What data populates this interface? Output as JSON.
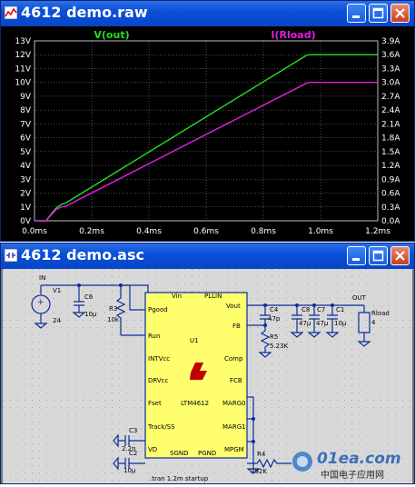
{
  "plot_window": {
    "title": "4612 demo.raw",
    "traces": {
      "left": "V(out)",
      "right": "I(Rload)"
    },
    "y_left_ticks": [
      "13V",
      "12V",
      "11V",
      "10V",
      "9V",
      "8V",
      "7V",
      "6V",
      "5V",
      "4V",
      "3V",
      "2V",
      "1V",
      "0V"
    ],
    "y_right_ticks": [
      "3.9A",
      "3.6A",
      "3.3A",
      "3.0A",
      "2.7A",
      "2.4A",
      "2.1A",
      "1.8A",
      "1.5A",
      "1.2A",
      "0.9A",
      "0.6A",
      "0.3A",
      "0.0A"
    ],
    "x_ticks": [
      "0.0ms",
      "0.2ms",
      "0.4ms",
      "0.6ms",
      "0.8ms",
      "1.0ms",
      "1.2ms"
    ],
    "colors": {
      "vout": "#22e022",
      "iload": "#e020e0",
      "grid": "#9a9a9a"
    }
  },
  "chart_data": {
    "type": "line",
    "x_unit": "ms",
    "ylim_left": [
      0,
      13
    ],
    "ylim_right": [
      0,
      3.9
    ],
    "xlim": [
      0,
      1.2
    ],
    "grid": true,
    "series": [
      {
        "name": "V(out)",
        "axis": "left",
        "x": [
          0.0,
          0.04,
          0.075,
          0.095,
          0.11,
          0.95,
          0.96,
          1.2
        ],
        "y": [
          0.0,
          0.0,
          0.9,
          1.2,
          1.3,
          11.95,
          12.0,
          12.0
        ]
      },
      {
        "name": "I(Rload)",
        "axis": "right",
        "x": [
          0.0,
          0.04,
          0.075,
          0.095,
          0.11,
          0.95,
          0.96,
          1.2
        ],
        "y": [
          0.0,
          0.0,
          0.24,
          0.3,
          0.32,
          2.98,
          3.0,
          3.0
        ]
      }
    ]
  },
  "sch_window": {
    "title": "4612 demo.asc",
    "labels": {
      "in": "IN",
      "out": "OUT",
      "v1": "V1",
      "v1val": "24",
      "c6": "C6",
      "c6val": "10µ",
      "r3": "R3",
      "r3val": "10k",
      "u1": "U1",
      "part": "LTM4612",
      "c4": "C4",
      "c4val": "47p",
      "r5": "R5",
      "r5val": "5.23K",
      "c8": "C8",
      "c8val": "47µ",
      "c7": "C7",
      "c7val": "47µ",
      "c1": "C1",
      "c1val": "10µ",
      "rload": "Rload",
      "rloadval": "4",
      "c3": "C3",
      "c3val": "2.2n",
      "c2": "C2",
      "c2val": "10µ",
      "r4": "R4",
      "r4val": "392K",
      "tran": ".tran 1.2m startup"
    },
    "pins": {
      "vin": "Vin",
      "pllin": "PLLIN",
      "vout": "Vout",
      "pgood": "Pgood",
      "run": "Run",
      "fb": "FB",
      "intvcc": "INTVcc",
      "comp": "Comp",
      "drvcc": "DRVcc",
      "fcb": "FCB",
      "fset": "Fset",
      "marg0": "MARG0",
      "track": "Track/SS",
      "marg1": "MARG1",
      "vd": "VD",
      "mpgm": "MPGM",
      "sgnd": "SGND",
      "pgnd": "PGND"
    }
  },
  "watermark": {
    "brand": "01ea.com",
    "sub": "中国电子应用网"
  }
}
